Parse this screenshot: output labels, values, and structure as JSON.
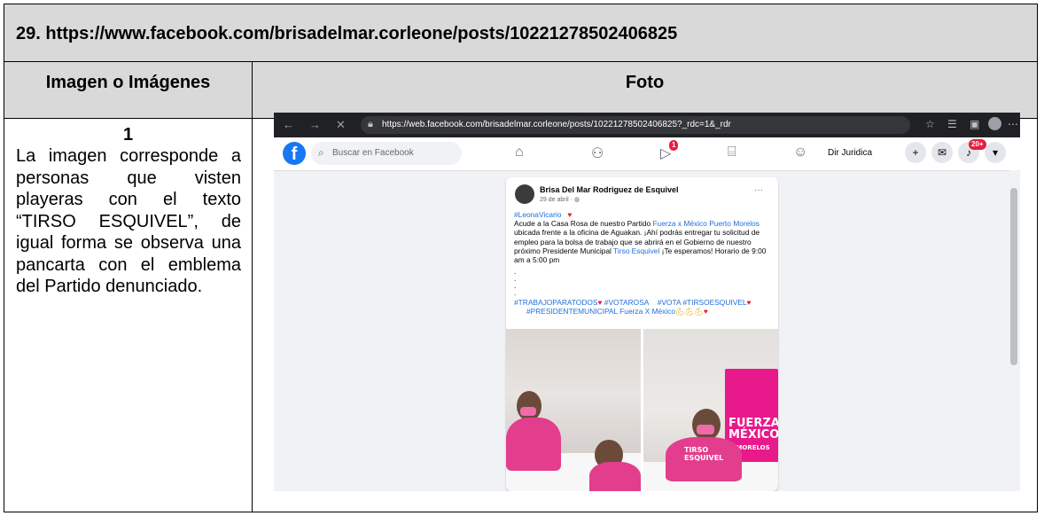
{
  "document": {
    "title": "29. https://www.facebook.com/brisadelmar.corleone/posts/10221278502406825",
    "header_left": "Imagen o Imágenes",
    "header_right": "Foto",
    "row_number": "1",
    "description": "La imagen corresponde a personas que visten playeras con el texto “TIRSO ESQUIVEL”, de igual forma se observa una pancarta con el emblema del Partido denunciado."
  },
  "browser": {
    "url": "https://web.facebook.com/brisadelmar.corleone/posts/10221278502406825?_rdc=1&_rdr",
    "back_icon": "←",
    "forward_icon": "→",
    "close_icon": "✕"
  },
  "facebook": {
    "search_placeholder": "Buscar en Facebook",
    "video_badge": "1",
    "notifications_badge": "20+",
    "user_name": "Dir Juridica"
  },
  "post": {
    "author": "Brisa Del Mar Rodriguez de Esquivel",
    "date": "29 de abril · ",
    "hashtag_top": "#LeonaVicario",
    "text_1": "Acude a la Casa Rosa de nuestro Partido ",
    "link_1": "Fuerza x México Puerto Morelos",
    "text_2": " ubicada frente a la oficina de Aguakan. ¡Ahí podrás entregar tu solicitud de empleo para la bolsa de trabajo que se abrirá en el Gobierno de nuestro próximo Presidente Municipal ",
    "link_2": "Tirso Esquivel",
    "text_3": " ¡Te esperamos! Horario de 9:00 am a 5:00 pm",
    "tags_1": "#TRABAJOPARATODOS",
    "tags_2": "#VOTAROSA",
    "tags_3": "#VOTA #TIRSOESQUIVEL",
    "tags_4": "#PRESIDENTEMUNICIPAL Fuerza X México",
    "banner_text": "FUERZA MÉXICO",
    "banner_sub": "O MORELOS",
    "shirt_text": "TIRSO ESQUIVEL"
  }
}
